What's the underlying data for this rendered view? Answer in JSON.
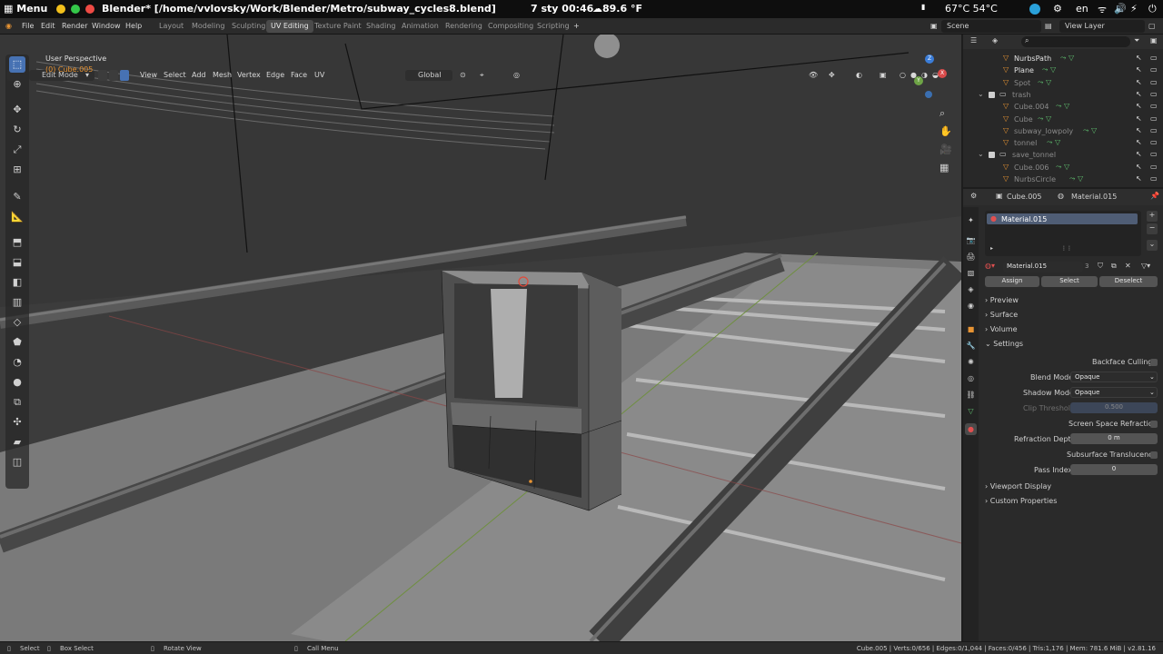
{
  "system_bar": {
    "menu_label": "Menu",
    "window_title": "Blender* [/home/vvlovsky/Work/Blender/Metro/subway_cycles8.blend]",
    "date_time": "7 sty  00:46",
    "weather": "89.6 °F",
    "temps": "67°C  54°C",
    "language": "en"
  },
  "top_menu": {
    "items": [
      "File",
      "Edit",
      "Render",
      "Window",
      "Help"
    ],
    "workspaces": [
      "Layout",
      "Modeling",
      "Sculpting",
      "UV Editing",
      "Texture Paint",
      "Shading",
      "Animation",
      "Rendering",
      "Compositing",
      "Scripting"
    ],
    "active_workspace": "UV Editing",
    "scene": "Scene",
    "view_layer": "View Layer"
  },
  "viewport_header": {
    "mode": "Edit Mode",
    "menus": [
      "View",
      "Select",
      "Add",
      "Mesh",
      "Vertex",
      "Edge",
      "Face",
      "UV"
    ],
    "transform_orientation": "Global"
  },
  "viewport": {
    "perspective_label": "User Perspective",
    "object_label": "(0) Cube.005",
    "gizmo_axes": [
      "X",
      "Y",
      "Z"
    ]
  },
  "outliner": {
    "rows": [
      {
        "name": "NurbsPath",
        "indent": 2,
        "dim": false
      },
      {
        "name": "Plane",
        "indent": 2,
        "dim": false
      },
      {
        "name": "Spot",
        "indent": 2,
        "dim": true
      },
      {
        "name": "trash",
        "indent": 1,
        "dim": true
      },
      {
        "name": "Cube.004",
        "indent": 2,
        "dim": true
      },
      {
        "name": "Cube",
        "indent": 2,
        "dim": true
      },
      {
        "name": "subway_lowpoly",
        "indent": 2,
        "dim": true
      },
      {
        "name": "tonnel",
        "indent": 2,
        "dim": true
      },
      {
        "name": "save_tonnel",
        "indent": 1,
        "dim": true
      },
      {
        "name": "Cube.006",
        "indent": 2,
        "dim": true
      },
      {
        "name": "NurbsCircle",
        "indent": 2,
        "dim": true
      }
    ]
  },
  "properties": {
    "object_name": "Cube.005",
    "material_name": "Material.015",
    "slot_name": "Material.015",
    "material_users": "3",
    "buttons": {
      "assign": "Assign",
      "select": "Select",
      "deselect": "Deselect"
    },
    "sections": {
      "preview": "Preview",
      "surface": "Surface",
      "volume": "Volume",
      "settings": "Settings",
      "viewport_display": "Viewport Display",
      "custom_properties": "Custom Properties"
    },
    "settings": {
      "backface_culling_label": "Backface Culling",
      "blend_mode_label": "Blend Mode",
      "blend_mode": "Opaque",
      "shadow_mode_label": "Shadow Mode",
      "shadow_mode": "Opaque",
      "clip_threshold_label": "Clip Threshold",
      "clip_threshold": "0.500",
      "ssr_label": "Screen Space Refraction",
      "refraction_depth_label": "Refraction Depth",
      "refraction_depth": "0 m",
      "subsurface_label": "Subsurface Translucency",
      "pass_index_label": "Pass Index",
      "pass_index": "0"
    }
  },
  "status_bar": {
    "select": "Select",
    "box_select": "Box Select",
    "rotate_view": "Rotate View",
    "call_menu": "Call Menu",
    "stats": "Cube.005 | Verts:0/656 | Edges:0/1,044 | Faces:0/456 | Tris:1,176 | Mem: 781.6 MiB | v2.81.16"
  },
  "colors": {
    "accent": "#4772b3",
    "header_bg": "#2b2b2b",
    "panel_bg": "#2a2a2a",
    "object_orange": "#e89433",
    "mesh_green": "#5fbf6f"
  }
}
